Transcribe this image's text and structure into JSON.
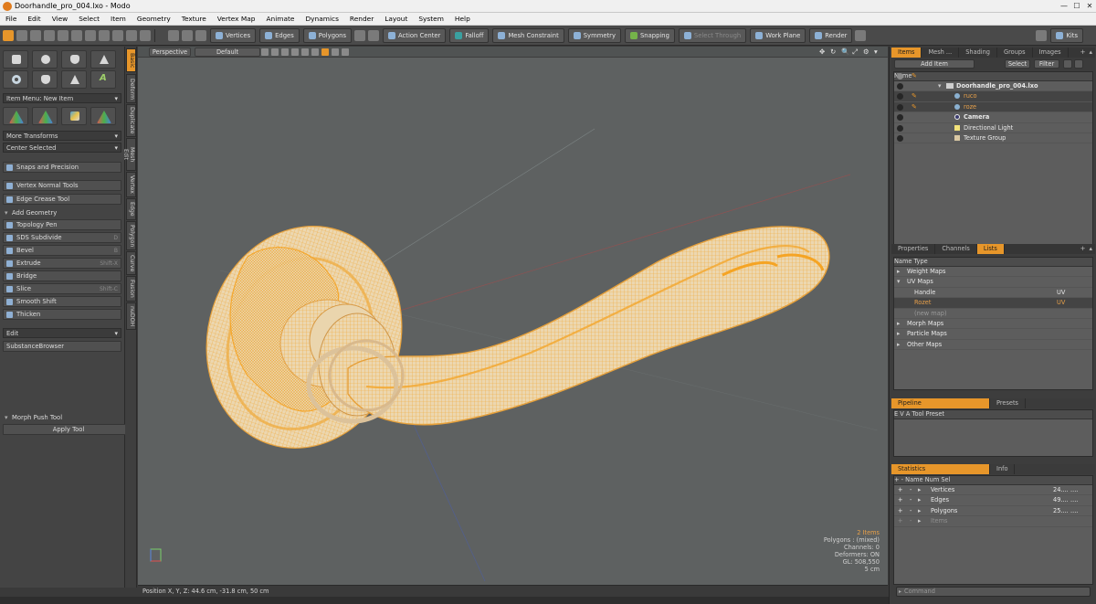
{
  "window": {
    "title": "Doorhandle_pro_004.lxo - Modo",
    "min": "—",
    "max": "☐",
    "close": "✕"
  },
  "menu": [
    "File",
    "Edit",
    "View",
    "Select",
    "Item",
    "Geometry",
    "Texture",
    "Vertex Map",
    "Animate",
    "Dynamics",
    "Render",
    "Layout",
    "System",
    "Help"
  ],
  "toolbar": {
    "vertices": "Vertices",
    "edges": "Edges",
    "polygons": "Polygons",
    "action_center": "Action Center",
    "falloff": "Falloff",
    "mesh_constraint": "Mesh Constraint",
    "symmetry": "Symmetry",
    "snapping": "Snapping",
    "select_through": "Select Through",
    "work_plane": "Work Plane",
    "render": "Render",
    "kits": "Kits"
  },
  "left_panel": {
    "item_menu": "Item Menu: New Item",
    "more_transforms": "More Transforms",
    "center_selected": "Center Selected",
    "snaps_precision": "Snaps and Precision",
    "vertex_normal_tools": "Vertex Normal Tools",
    "edge_crease_tool": "Edge Crease Tool",
    "add_geometry": "Add Geometry",
    "geometry_tools": [
      {
        "label": "Topology Pen",
        "shortcut": ""
      },
      {
        "label": "SDS Subdivide",
        "shortcut": "D"
      },
      {
        "label": "Bevel",
        "shortcut": "B"
      },
      {
        "label": "Extrude",
        "shortcut": "Shift-X"
      },
      {
        "label": "Bridge",
        "shortcut": ""
      },
      {
        "label": "Slice",
        "shortcut": "Shift-C"
      },
      {
        "label": "Smooth Shift",
        "shortcut": ""
      },
      {
        "label": "Thicken",
        "shortcut": ""
      }
    ],
    "edit": "Edit",
    "substance_browser": "SubstanceBrowser",
    "morph_push_tool": "Morph Push Tool",
    "apply_tool": "Apply Tool"
  },
  "vertical_tabs": [
    "Basic",
    "Deform",
    "Duplicate",
    "Mesh Edit",
    "Vertex",
    "Edge",
    "Polygon",
    "Curve",
    "Fusion",
    "nuDOH"
  ],
  "viewport": {
    "view_mode": "Perspective",
    "shading": "Default",
    "nav_icons": [
      "✥",
      "↻",
      "🔍",
      "⤢",
      "⚙",
      "▾"
    ],
    "stats": {
      "items": "2 Items",
      "polygons": "Polygons : (mixed)",
      "channels": "Channels: 0",
      "deformers": "Deformers: ON",
      "gl": "GL: 508,550",
      "scale": "5 cm"
    }
  },
  "status": {
    "position": "Position X, Y, Z:   44.6 cm, -31.8 cm, 50 cm"
  },
  "items_panel": {
    "tabs": [
      "Items",
      "Mesh ...",
      "Shading",
      "Groups",
      "Images"
    ],
    "add_item": "Add Item",
    "select": "Select",
    "filter": "Filter",
    "name_header": "Name",
    "rows": [
      {
        "name": "Doorhandle_pro_004.lxo",
        "bold": true
      },
      {
        "name": "ruco",
        "orange": true
      },
      {
        "name": "roze",
        "orange": true
      },
      {
        "name": "Camera",
        "bold": true
      },
      {
        "name": "Directional Light",
        "bold": false
      },
      {
        "name": "Texture Group",
        "bold": false
      }
    ]
  },
  "lists_panel": {
    "tabs": [
      "Properties",
      "Channels",
      "Lists"
    ],
    "name_header": "Name",
    "type_header": "Type",
    "rows": [
      {
        "name": "Weight Maps",
        "type": ""
      },
      {
        "name": "UV Maps",
        "type": ""
      },
      {
        "name": "Handle",
        "type": "UV"
      },
      {
        "name": "Rozet",
        "type": "UV"
      },
      {
        "name": "(new map)",
        "type": ""
      },
      {
        "name": "Morph Maps",
        "type": ""
      },
      {
        "name": "Particle Maps",
        "type": ""
      },
      {
        "name": "Other Maps",
        "type": ""
      }
    ]
  },
  "pipeline_panel": {
    "tabs": [
      "Pipeline",
      "Presets"
    ],
    "headers": [
      "E",
      "V",
      "A",
      "Tool",
      "Preset"
    ]
  },
  "statistics_panel": {
    "tabs": [
      "Statistics",
      "Info"
    ],
    "headers": [
      "+",
      "-",
      "Name",
      "Num",
      "Sel"
    ],
    "rows": [
      {
        "name": "Vertices",
        "num": "24....",
        "sel": "...."
      },
      {
        "name": "Edges",
        "num": "49....",
        "sel": "...."
      },
      {
        "name": "Polygons",
        "num": "25....",
        "sel": "...."
      },
      {
        "name": "Items",
        "num": "",
        "sel": ""
      }
    ]
  },
  "command": {
    "placeholder": "Command"
  },
  "colors": {
    "accent": "#e7962a",
    "wire": "#f0a93a",
    "model": "#e8d2aa"
  }
}
